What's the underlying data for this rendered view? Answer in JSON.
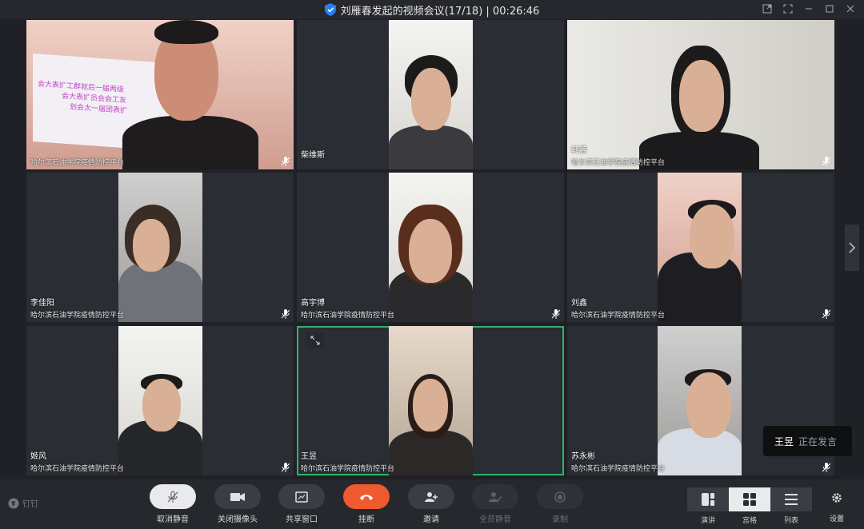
{
  "window": {
    "title": "刘雁春发起的视频会议(17/18) | 00:26:46"
  },
  "org_label": "哈尔滨石油学院疫情防控平台",
  "participants": [
    {
      "name": "",
      "org": "哈尔滨石油学院疫情防控平台",
      "slide_lines": [
        "会大表扩工群就后一届两级",
        "会大表扩员会会工友",
        "划会太一届团表扩"
      ]
    },
    {
      "name": "柴维斯",
      "org": ""
    },
    {
      "name": "韩蓉",
      "org": "哈尔滨石油学院疫情防控平台"
    },
    {
      "name": "李佳阳",
      "org": "哈尔滨石油学院疫情防控平台"
    },
    {
      "name": "高宇博",
      "org": "哈尔滨石油学院疫情防控平台"
    },
    {
      "name": "刘鑫",
      "org": "哈尔滨石油学院疫情防控平台"
    },
    {
      "name": "姬风",
      "org": "哈尔滨石油学院疫情防控平台"
    },
    {
      "name": "王昱",
      "org": "哈尔滨石油学院疫情防控平台"
    },
    {
      "name": "苏永彬",
      "org": "哈尔滨石油学院疫情防控平台"
    }
  ],
  "speaking_toast": {
    "speaker": "王昱",
    "status": "正在发言"
  },
  "toolbar": {
    "logo": "钉钉",
    "unmute": "取消静音",
    "camera_off": "关闭摄像头",
    "share": "共享窗口",
    "hangup": "挂断",
    "invite": "邀请",
    "mute_all": "全员静音",
    "record": "录制",
    "layout_speaker": "演讲",
    "layout_grid": "宫格",
    "layout_list": "列表",
    "settings": "设置"
  },
  "colors": {
    "accent_green": "#2fb36a",
    "hangup_red": "#ef5a2e"
  }
}
